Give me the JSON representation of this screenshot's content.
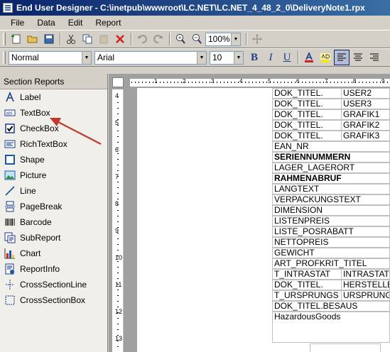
{
  "window": {
    "title": "End User Designer - C:\\inetpub\\wwwroot\\LC.NET\\LC.NET_4_48_2_0\\DeliveryNote1.rpx"
  },
  "menu": [
    "File",
    "Data",
    "Edit",
    "Report"
  ],
  "toolbar": {
    "zoom_value": "100%"
  },
  "format": {
    "style_value": "Normal",
    "font_value": "Arial",
    "size_value": "10"
  },
  "panel": {
    "header": "Section Reports",
    "items": [
      {
        "label": "Label",
        "icon": "label-icon"
      },
      {
        "label": "TextBox",
        "icon": "textbox-icon"
      },
      {
        "label": "CheckBox",
        "icon": "checkbox-icon"
      },
      {
        "label": "RichTextBox",
        "icon": "richtextbox-icon"
      },
      {
        "label": "Shape",
        "icon": "shape-icon"
      },
      {
        "label": "Picture",
        "icon": "picture-icon"
      },
      {
        "label": "Line",
        "icon": "line-icon"
      },
      {
        "label": "PageBreak",
        "icon": "pagebreak-icon"
      },
      {
        "label": "Barcode",
        "icon": "barcode-icon"
      },
      {
        "label": "SubReport",
        "icon": "subreport-icon"
      },
      {
        "label": "Chart",
        "icon": "chart-icon"
      },
      {
        "label": "ReportInfo",
        "icon": "reportinfo-icon"
      },
      {
        "label": "CrossSectionLine",
        "icon": "crosssectionline-icon"
      },
      {
        "label": "CrossSectionBox",
        "icon": "crosssectionbox-icon"
      }
    ]
  },
  "ruler": {
    "h_marks": [
      "1",
      "2",
      "3",
      "4",
      "5",
      "6",
      "7",
      "8",
      "9"
    ],
    "v_marks": [
      "4",
      "5",
      "6",
      "7",
      "8",
      "9",
      "10",
      "11",
      "12",
      "13"
    ]
  },
  "fields": [
    {
      "a": "DOK_TITEL.",
      "b": "USER2"
    },
    {
      "a": "DOK_TITEL.",
      "b": "USER3"
    },
    {
      "a": "DOK_TITEL.",
      "b": "GRAFIK1"
    },
    {
      "a": "DOK_TITEL.",
      "b": "GRAFIK2"
    },
    {
      "a": "DOK_TITEL.",
      "b": "GRAFIK3"
    },
    {
      "a": "EAN_NR"
    },
    {
      "a": "SERIENNUMMERN",
      "bold": true
    },
    {
      "a": "LAGER_LAGERORT"
    },
    {
      "a": "RAHMENABRUF",
      "bold": true
    },
    {
      "a": "LANGTEXT"
    },
    {
      "a": "VERPACKUNGSTEXT"
    },
    {
      "a": "DIMENSION"
    },
    {
      "a": "LISTENPREIS"
    },
    {
      "a": "LISTE_POSRABATT"
    },
    {
      "a": "NETTOPREIS"
    },
    {
      "a": "GEWICHT"
    },
    {
      "a": "ART_PROFKRIT_TITEL"
    },
    {
      "a": "T_INTRASTAT",
      "b": "INTRASTAT"
    },
    {
      "a": "DOK_TITEL.",
      "b": "HERSTELLE"
    },
    {
      "a": "T_URSPRUNGS",
      "b": "URSPRUNG"
    },
    {
      "a": "DOK_TITEL.BESAUS"
    },
    {
      "a": "HazardousGoods"
    }
  ],
  "colors": {
    "titlebar": "#0a246a",
    "annotation_arrow": "#c0392b"
  }
}
